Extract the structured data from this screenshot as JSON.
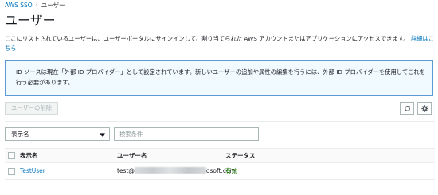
{
  "breadcrumb": {
    "root": "AWS SSO",
    "current": "ユーザー"
  },
  "page": {
    "title": "ユーザー",
    "description": "ここにリストされているユーザーは、ユーザーポータルにサインインして、割り当てられた AWS アカウントまたはアプリケーションにアクセスできます。",
    "more_link": "詳細はこちら"
  },
  "info_box": {
    "text": "ID ソースは現在「外部 ID プロバイダー」として設定されています。新しいユーザーの追加や属性の編集を行うには、外部 ID プロバイダーを使用してこれを行う必要があります。"
  },
  "toolbar": {
    "delete_label": "ユーザーの削除",
    "refresh_icon": "refresh-icon",
    "settings_icon": "gear-icon"
  },
  "filter": {
    "select_value": "表示名",
    "search_placeholder": "検索条件"
  },
  "table": {
    "columns": [
      "表示名",
      "ユーザー名",
      "ステータス"
    ],
    "rows": [
      {
        "display_name": "TestUser",
        "username_prefix": "test@",
        "username_suffix": "osoft.com",
        "status": "有効"
      }
    ]
  },
  "colors": {
    "link": "#0073bb",
    "status_ok": "#1d8102",
    "info_border": "#5b9bd5",
    "info_bg": "#f1faff"
  }
}
